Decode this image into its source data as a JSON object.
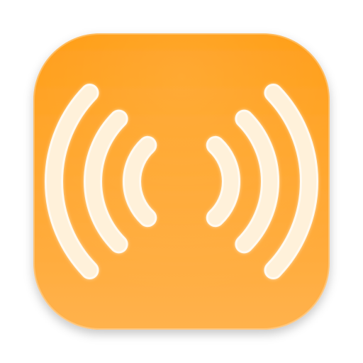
{
  "app_icon": {
    "icon": "broadcast-waves-icon",
    "colors": {
      "background_top": "#ff9a0e",
      "background_bottom": "#ffb24d",
      "wave_fill": "#fff1da",
      "wave_stroke": "#fffaf1"
    },
    "waves_per_side": 3
  }
}
